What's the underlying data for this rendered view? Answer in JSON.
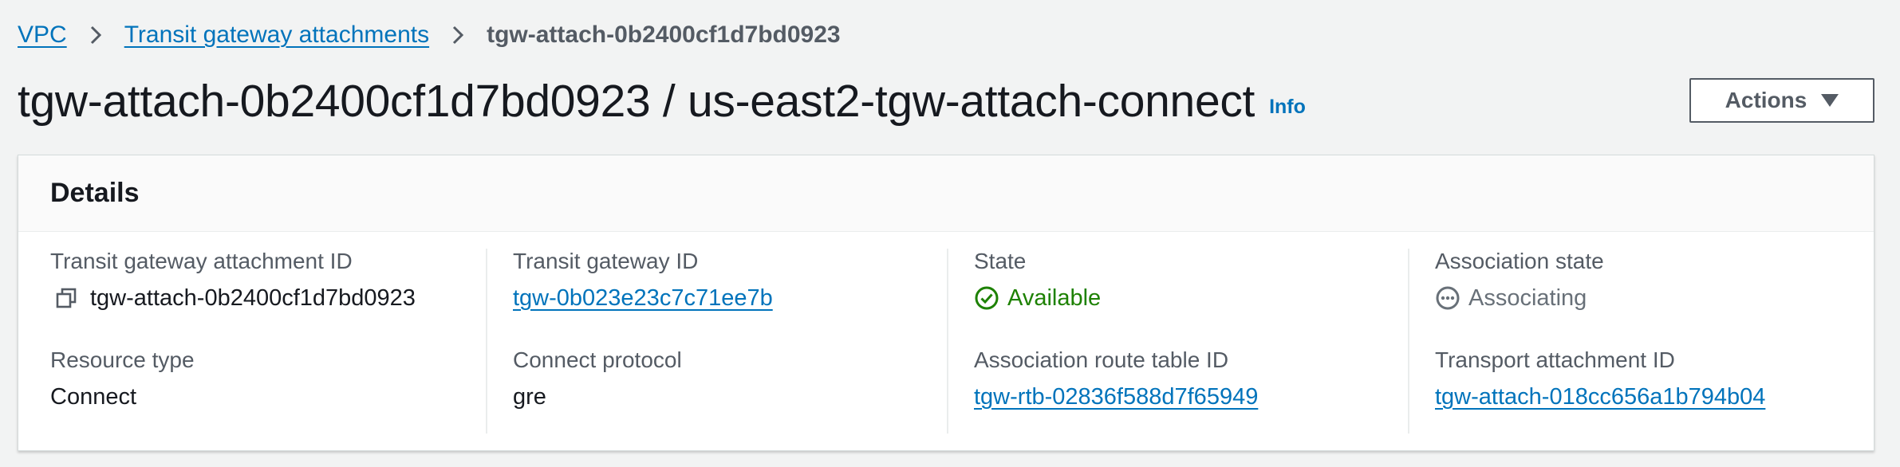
{
  "breadcrumb": {
    "items": [
      "VPC",
      "Transit gateway attachments"
    ],
    "current": "tgw-attach-0b2400cf1d7bd0923"
  },
  "header": {
    "title": "tgw-attach-0b2400cf1d7bd0923 / us-east2-tgw-attach-connect",
    "info": "Info",
    "actions_label": "Actions"
  },
  "details": {
    "title": "Details",
    "fields": [
      {
        "label": "Transit gateway attachment ID",
        "value": "tgw-attach-0b2400cf1d7bd0923"
      },
      {
        "label": "Transit gateway ID",
        "value": "tgw-0b023e23c7c71ee7b"
      },
      {
        "label": "State",
        "value": "Available"
      },
      {
        "label": "Association state",
        "value": "Associating"
      },
      {
        "label": "Resource type",
        "value": "Connect"
      },
      {
        "label": "Connect protocol",
        "value": "gre"
      },
      {
        "label": "Association route table ID",
        "value": "tgw-rtb-02836f588d7f65949"
      },
      {
        "label": "Transport attachment ID",
        "value": "tgw-attach-018cc656a1b794b04"
      }
    ]
  },
  "icons": {
    "breadcrumb_separator": "chevron-right-icon",
    "copy": "copy-icon",
    "available": "check-circle-icon",
    "associating": "pending-circle-icon",
    "actions_caret": "caret-down-icon"
  },
  "colors": {
    "link": "#0073bb",
    "success": "#1d8102",
    "pending": "#687078",
    "background": "#f2f3f3"
  }
}
